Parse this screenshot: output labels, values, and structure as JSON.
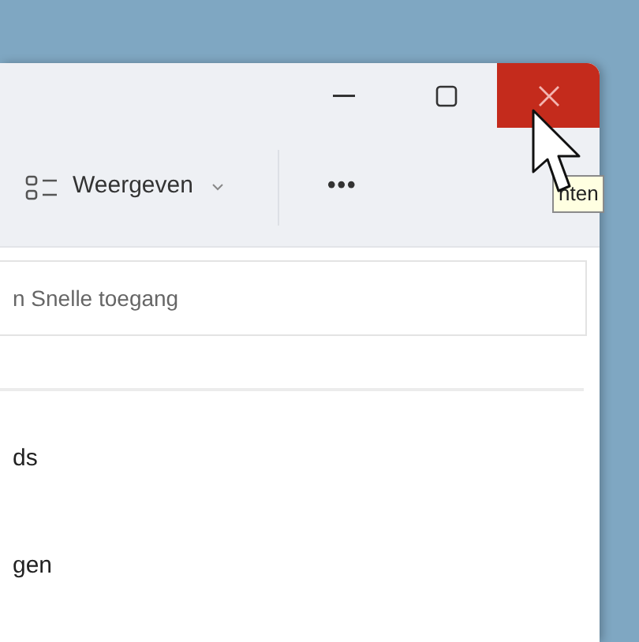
{
  "toolbar": {
    "view_button": {
      "label": "Weergeven"
    },
    "more_button": {
      "label": "•••"
    }
  },
  "tooltip": {
    "text": "nten"
  },
  "search": {
    "placeholder": "n Snelle toegang"
  },
  "items": [
    {
      "label": "ds"
    },
    {
      "label": "gen"
    }
  ]
}
